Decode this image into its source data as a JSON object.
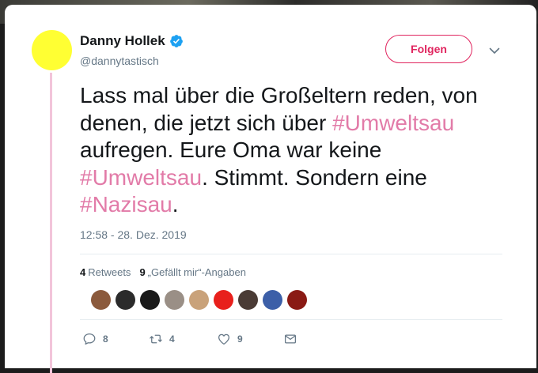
{
  "tweet": {
    "author_name": "Danny Hollek",
    "handle": "@dannytastisch",
    "follow_label": "Folgen",
    "text_segments": [
      {
        "text": "Lass mal über die Großeltern reden, von denen, die jetzt sich über ",
        "hashtag": false
      },
      {
        "text": "#Umweltsau",
        "hashtag": true
      },
      {
        "text": " aufregen. Eure Oma war keine ",
        "hashtag": false
      },
      {
        "text": "#Umweltsau",
        "hashtag": true
      },
      {
        "text": ". Stimmt. Sondern eine ",
        "hashtag": false
      },
      {
        "text": "#Nazisau",
        "hashtag": true
      },
      {
        "text": ".",
        "hashtag": false
      }
    ],
    "timestamp": "12:58 - 28. Dez. 2019"
  },
  "stats": {
    "retweets_count": "4",
    "retweets_label": "Retweets",
    "likes_count": "9",
    "likes_label": "„Gefällt mir“-Angaben"
  },
  "likers": [
    {
      "icon": "liker-avatar",
      "color": "#8b5a3c"
    },
    {
      "icon": "liker-avatar",
      "color": "#2b2b2b"
    },
    {
      "icon": "liker-avatar",
      "color": "#1a1a1a"
    },
    {
      "icon": "liker-avatar",
      "color": "#9a8f86"
    },
    {
      "icon": "liker-avatar",
      "color": "#c9a27a"
    },
    {
      "icon": "liker-avatar",
      "color": "#e8201c"
    },
    {
      "icon": "liker-avatar",
      "color": "#4a3b35"
    },
    {
      "icon": "liker-avatar",
      "color": "#3c5fa8"
    },
    {
      "icon": "liker-avatar",
      "color": "#8a1a14"
    }
  ],
  "actions": {
    "reply_count": "8",
    "retweet_count": "4",
    "like_count": "9"
  },
  "colors": {
    "accent": "#e0245e",
    "hashtag": "#e27ba8",
    "verified": "#1da1f2",
    "avatar": "#ffff33"
  }
}
